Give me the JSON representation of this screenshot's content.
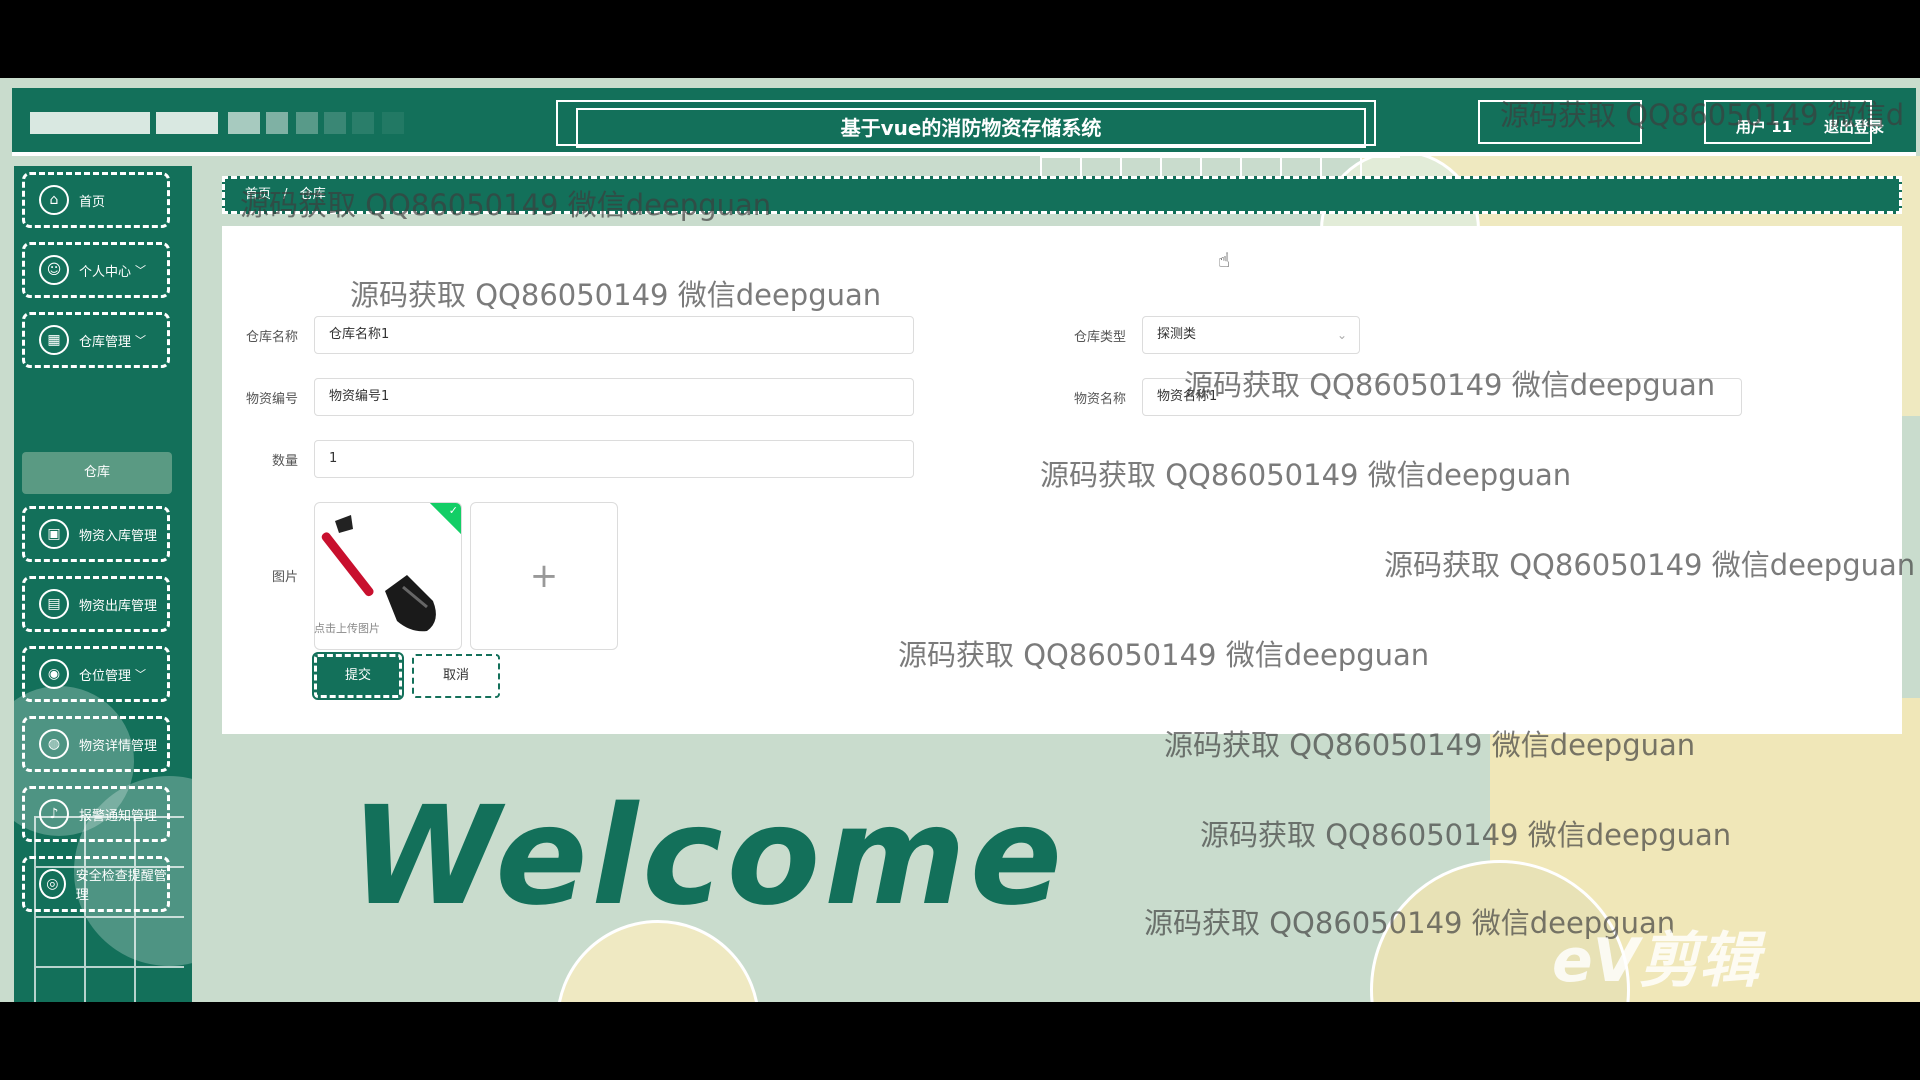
{
  "header": {
    "title": "基于vue的消防物资存储系统",
    "user": "用户 11",
    "logout": "退出登录"
  },
  "sidebar": {
    "items": [
      {
        "label": "首页",
        "icon": "home-icon"
      },
      {
        "label": "个人中心",
        "icon": "user-icon",
        "chevron": "﹀"
      },
      {
        "label": "仓库管理",
        "icon": "grid-icon",
        "chevron": "﹀"
      },
      {
        "label": "物资入库管理",
        "icon": "box-in-icon"
      },
      {
        "label": "物资出库管理",
        "icon": "box-out-icon"
      },
      {
        "label": "仓位管理",
        "icon": "location-icon",
        "chevron": "﹀"
      },
      {
        "label": "物资详情管理",
        "icon": "detail-icon"
      },
      {
        "label": "报警通知管理",
        "icon": "alarm-icon"
      },
      {
        "label": "安全检查提醒管理",
        "icon": "shield-icon"
      }
    ],
    "sub_item": "仓库"
  },
  "breadcrumb": {
    "home": "首页",
    "sep": "/",
    "current": "仓库"
  },
  "form": {
    "warehouse_name_label": "仓库名称",
    "warehouse_name_value": "仓库名称1",
    "warehouse_type_label": "仓库类型",
    "warehouse_type_value": "探测类",
    "item_code_label": "物资编号",
    "item_code_value": "物资编号1",
    "item_name_label": "物资名称",
    "item_name_value": "物资名称1",
    "quantity_label": "数量",
    "quantity_value": "1",
    "image_label": "图片",
    "upload_plus": "+",
    "upload_hint": "点击上传图片",
    "submit": "提交",
    "cancel": "取消"
  },
  "background": {
    "welcome": "Welcome"
  },
  "watermark": {
    "text": "源码获取 QQ86050149 微信deepguan",
    "partial": "源码获取 QQ86050149 微信d"
  },
  "video_logo": "eV剪辑",
  "colors": {
    "primary": "#13705a",
    "accent_bg": "#c9dccd",
    "yellow": "#efe9c0"
  }
}
